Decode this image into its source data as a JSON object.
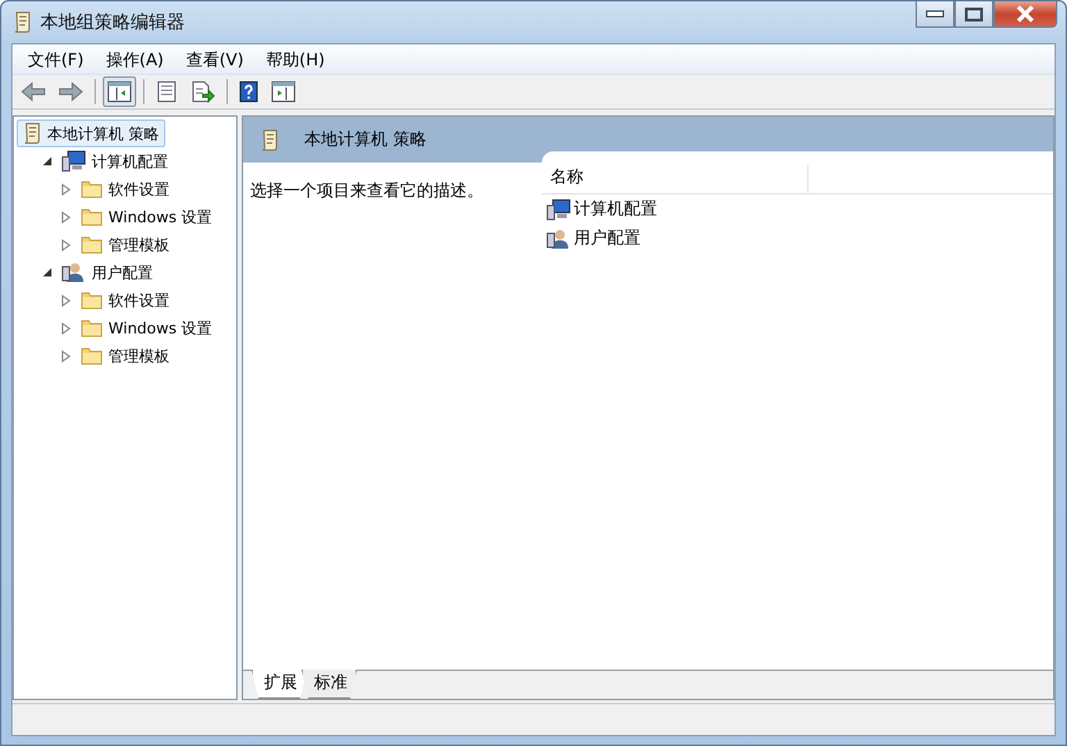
{
  "window": {
    "title": "本地组策略编辑器"
  },
  "menu": [
    {
      "label": "文件(F)"
    },
    {
      "label": "操作(A)"
    },
    {
      "label": "查看(V)"
    },
    {
      "label": "帮助(H)"
    }
  ],
  "tree": [
    {
      "label": "本地计算机 策略",
      "kind": "policy",
      "selected": true,
      "children": [
        {
          "label": "计算机配置",
          "kind": "computer",
          "selected": false,
          "expanded": true,
          "children": [
            {
              "label": "软件设置",
              "kind": "folder",
              "selected": false,
              "expanded": false
            },
            {
              "label": "Windows 设置",
              "kind": "folder",
              "selected": false,
              "expanded": false
            },
            {
              "label": "管理模板",
              "kind": "folder",
              "selected": false,
              "expanded": false
            }
          ]
        },
        {
          "label": "用户配置",
          "kind": "user",
          "selected": false,
          "expanded": true,
          "children": [
            {
              "label": "软件设置",
              "kind": "folder",
              "selected": false,
              "expanded": false
            },
            {
              "label": "Windows 设置",
              "kind": "folder",
              "selected": false,
              "expanded": false
            },
            {
              "label": "管理模板",
              "kind": "folder",
              "selected": false,
              "expanded": false
            }
          ]
        }
      ]
    }
  ],
  "details": {
    "title": "本地计算机 策略",
    "description": "选择一个项目来查看它的描述。",
    "columns": [
      "名称"
    ],
    "rows": [
      {
        "label": "计算机配置",
        "kind": "computer"
      },
      {
        "label": "用户配置",
        "kind": "user"
      }
    ]
  },
  "tabs": [
    {
      "label": "扩展",
      "selected": true
    },
    {
      "label": "标准",
      "selected": false
    }
  ]
}
